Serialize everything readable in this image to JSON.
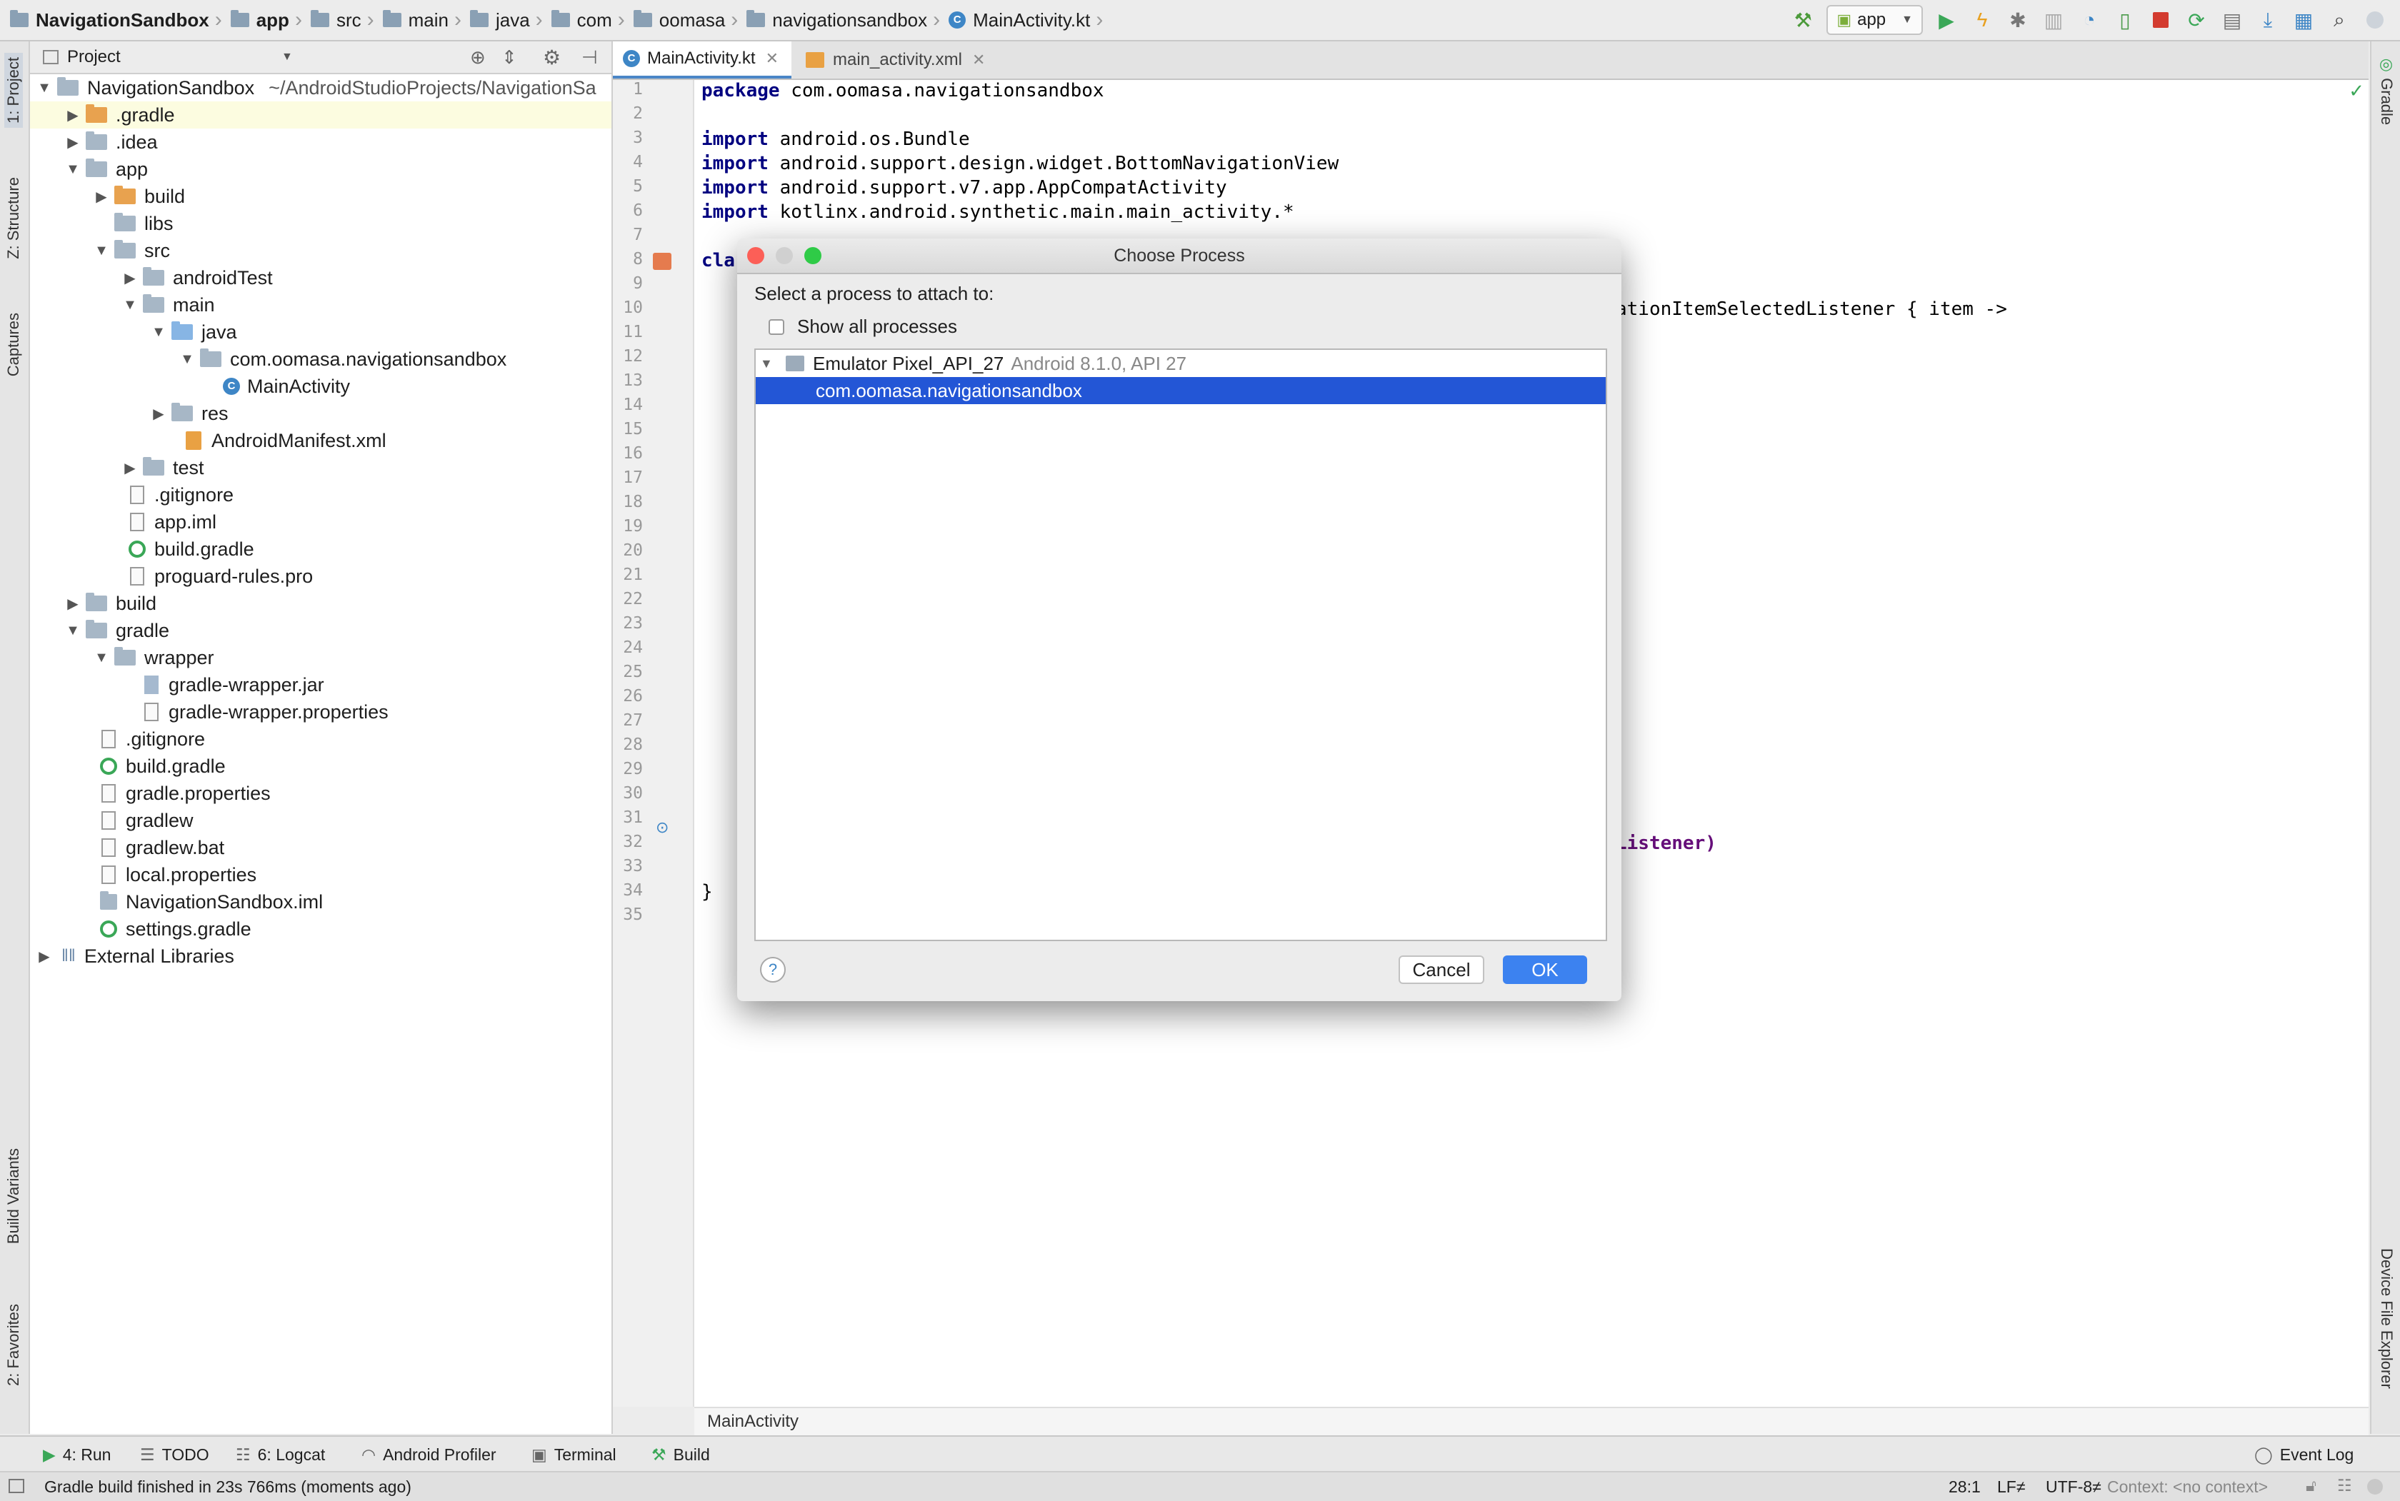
{
  "navbar": {
    "crumbs": [
      "NavigationSandbox",
      "app",
      "src",
      "main",
      "java",
      "com",
      "oomasa",
      "navigationsandbox",
      "MainActivity.kt"
    ],
    "run_config": "app"
  },
  "left_stripe": {
    "project": "1: Project",
    "structure": "Z: Structure",
    "captures": "Captures",
    "build_variants": "Build Variants",
    "favorites": "2: Favorites"
  },
  "right_stripe": {
    "gradle": "Gradle",
    "device_file_explorer": "Device File Explorer"
  },
  "project_panel": {
    "title": "Project",
    "root_name": "NavigationSandbox",
    "root_path": "~/AndroidStudioProjects/NavigationSa",
    "items": [
      ".gradle",
      ".idea",
      "app",
      "build",
      "libs",
      "src",
      "androidTest",
      "main",
      "java",
      "com.oomasa.navigationsandbox",
      "MainActivity",
      "res",
      "AndroidManifest.xml",
      "test",
      ".gitignore",
      "app.iml",
      "build.gradle",
      "proguard-rules.pro",
      "build",
      "gradle",
      "wrapper",
      "gradle-wrapper.jar",
      "gradle-wrapper.properties",
      ".gitignore",
      "build.gradle",
      "gradle.properties",
      "gradlew",
      "gradlew.bat",
      "local.properties",
      "NavigationSandbox.iml",
      "settings.gradle",
      "External Libraries"
    ]
  },
  "editor": {
    "tabs": [
      "MainActivity.kt",
      "main_activity.xml"
    ],
    "line_numbers": [
      "1",
      "2",
      "3",
      "4",
      "5",
      "6",
      "7",
      "8",
      "9",
      "10",
      "11",
      "12",
      "13",
      "14",
      "15",
      "16",
      "17",
      "18",
      "19",
      "20",
      "21",
      "22",
      "23",
      "24",
      "25",
      "26",
      "27",
      "28",
      "29",
      "30",
      "31",
      "32",
      "33",
      "34",
      "35"
    ],
    "code": {
      "l1_kw": "package",
      "l1": " com.oomasa.navigationsandbox",
      "l3_kw": "import",
      "l3": " android.os.Bundle",
      "l4_kw": "import",
      "l4": " android.support.design.widget.BottomNavigationView",
      "l5_kw": "import",
      "l5": " android.support.v7.app.AppCompatActivity",
      "l6_kw": "import",
      "l6": " kotlinx.android.synthetic.main.main_activity.*",
      "l8": "cla",
      "l10": "ationItemSelectedListener { item ->",
      "l32": "Listener)",
      "l34": "}"
    },
    "breadcrumb": "MainActivity"
  },
  "dialog": {
    "title": "Choose Process",
    "prompt": "Select a process to attach to:",
    "show_all_label": "Show all processes",
    "device": "Emulator Pixel_API_27",
    "device_detail": "Android 8.1.0, API 27",
    "process": "com.oomasa.navigationsandbox",
    "help": "?",
    "cancel": "Cancel",
    "ok": "OK"
  },
  "toolwindows": {
    "run": "4: Run",
    "todo": "TODO",
    "logcat": "6: Logcat",
    "profiler": "Android Profiler",
    "terminal": "Terminal",
    "build": "Build",
    "event_log": "Event Log"
  },
  "status": {
    "message": "Gradle build finished in 23s 766ms (moments ago)",
    "position": "28:1",
    "line_sep": "LF≠",
    "encoding": "UTF-8≠",
    "context": "Context: <no context>"
  },
  "colors": {
    "selection": "#2356d6",
    "ok_button": "#3c82f0",
    "keyword": "#000080",
    "gradle_green": "#3aa757"
  }
}
